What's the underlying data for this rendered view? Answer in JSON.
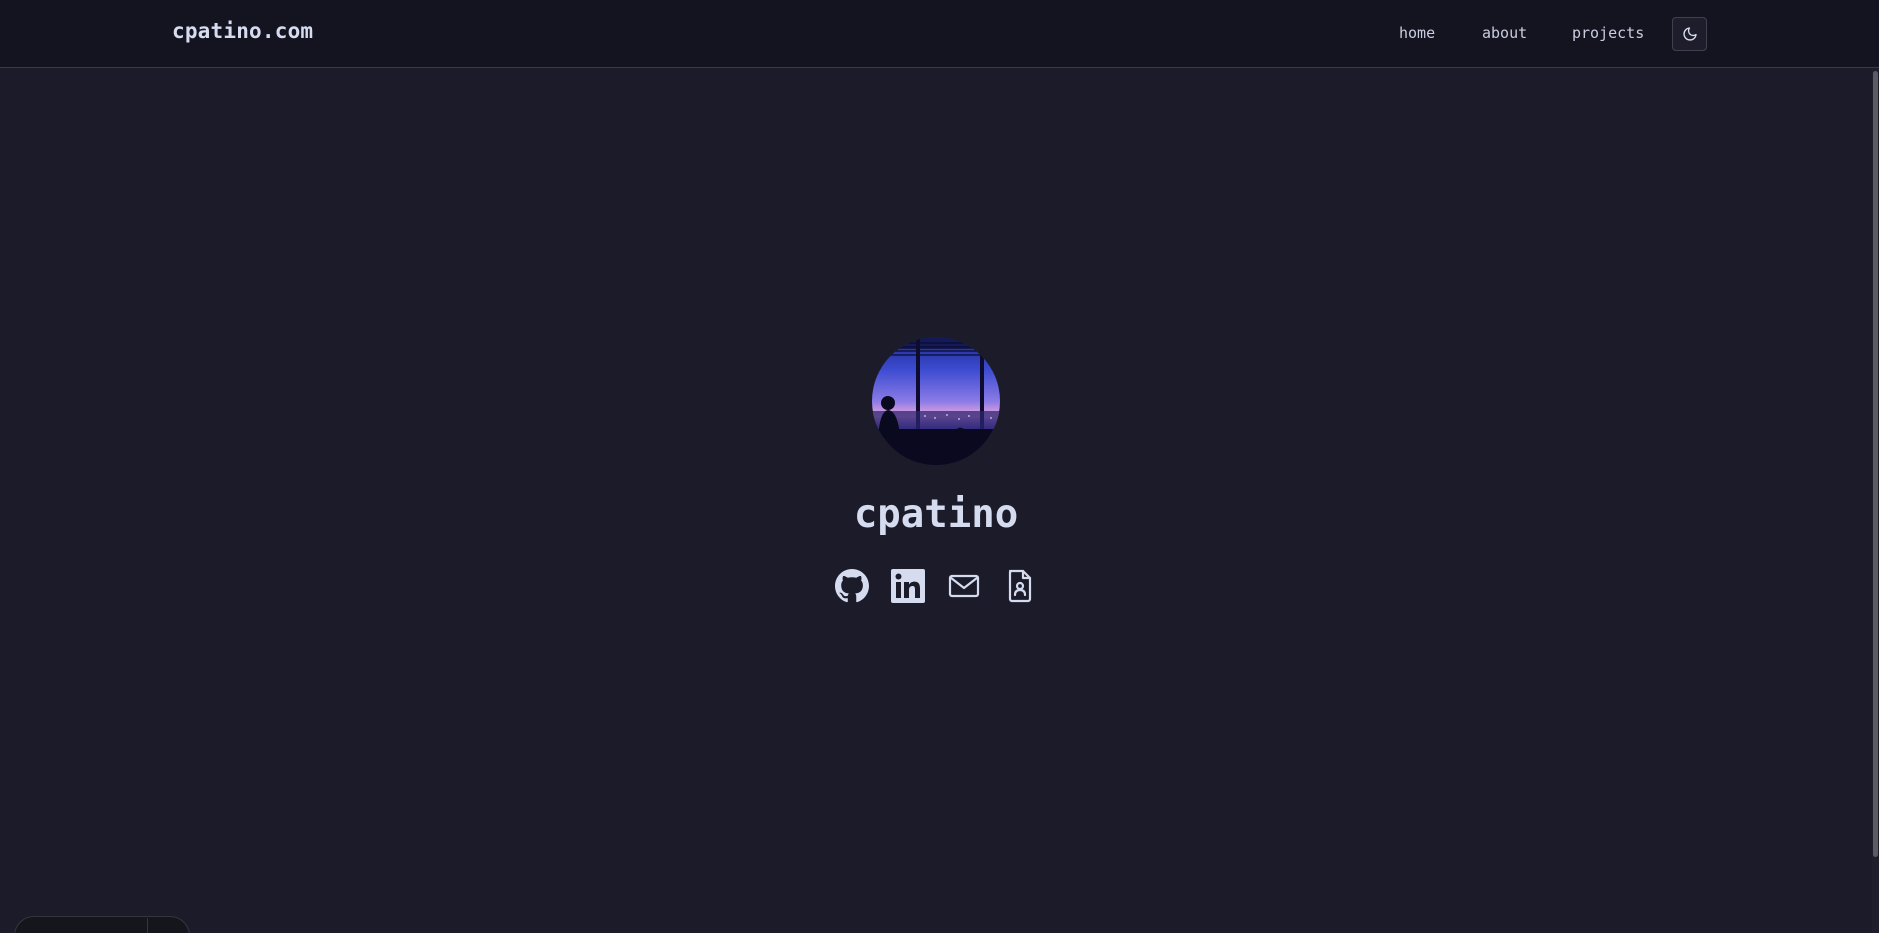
{
  "header": {
    "brand": "cpatino.com",
    "nav": [
      {
        "label": "home"
      },
      {
        "label": "about"
      },
      {
        "label": "projects"
      }
    ],
    "theme_toggle_icon": "moon-icon"
  },
  "profile": {
    "name": "cpatino",
    "social_icons": [
      "github-icon",
      "linkedin-icon",
      "mail-icon",
      "resume-icon"
    ]
  },
  "colors": {
    "background": "#1b1b29",
    "navbar": "#141421",
    "text": "#d6dcf0"
  }
}
